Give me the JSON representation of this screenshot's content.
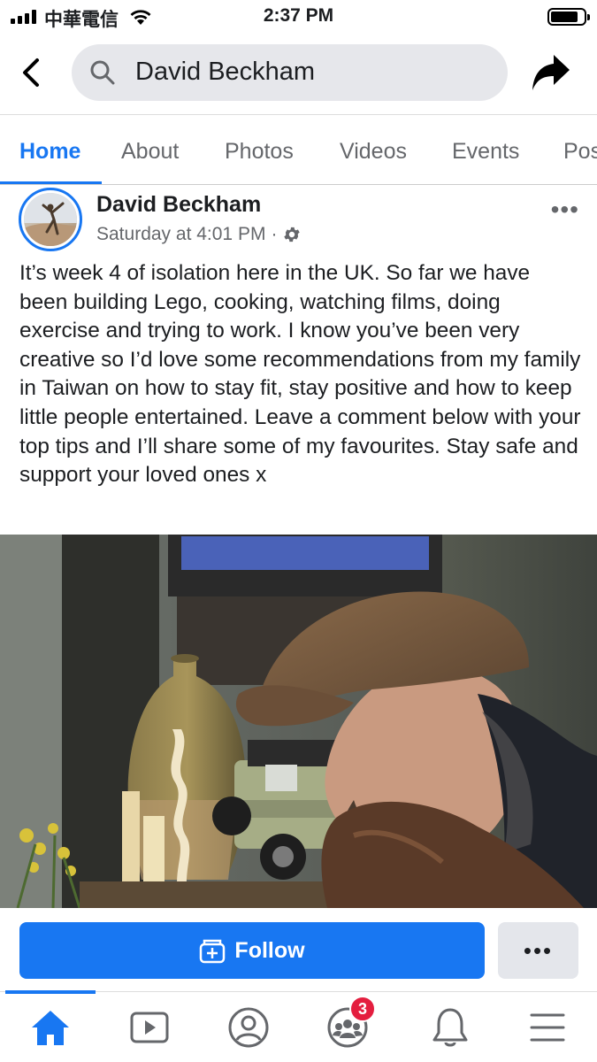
{
  "status_bar": {
    "carrier": "中華電信",
    "time": "2:37 PM"
  },
  "header": {
    "search_text": "David Beckham",
    "back_icon": "chevron-left-icon",
    "search_icon": "search-icon",
    "share_icon": "share-arrow-icon"
  },
  "tabs": [
    {
      "label": "Home",
      "active": true
    },
    {
      "label": "About"
    },
    {
      "label": "Photos"
    },
    {
      "label": "Videos"
    },
    {
      "label": "Events"
    },
    {
      "label": "Pos"
    }
  ],
  "post": {
    "author": "David Beckham",
    "timestamp": "Saturday at 4:01 PM",
    "separator": "·",
    "privacy_icon": "gear-icon",
    "text": "It’s week 4 of isolation here in the UK. So far we have been building Lego, cooking, watching films, doing exercise and trying to work. I know you’ve been very creative so I’d love some recommendations from my family in Taiwan on how to stay fit, stay positive and how to keep little people entertained. Leave a comment below with your top tips and I’ll share some of my favourites. Stay safe and support your loved ones x"
  },
  "actions": {
    "follow_label": "Follow",
    "more_label": "•••"
  },
  "bottom_nav": {
    "items": [
      {
        "icon": "home-icon",
        "active": true
      },
      {
        "icon": "watch-icon"
      },
      {
        "icon": "profile-icon"
      },
      {
        "icon": "groups-icon",
        "badge": "3"
      },
      {
        "icon": "bell-icon"
      },
      {
        "icon": "menu-icon"
      }
    ]
  },
  "colors": {
    "accent": "#1877f2",
    "badge": "#e41e3f",
    "secondary_text": "#65676b"
  }
}
